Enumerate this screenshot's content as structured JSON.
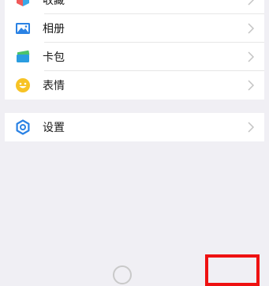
{
  "menu": {
    "items": [
      {
        "label": "收藏",
        "icon": "favorites-cube-icon"
      },
      {
        "label": "相册",
        "icon": "album-image-icon"
      },
      {
        "label": "卡包",
        "icon": "card-wallet-icon"
      },
      {
        "label": "表情",
        "icon": "emoji-smiley-icon"
      }
    ],
    "settings": {
      "label": "设置",
      "icon": "settings-gear-icon"
    }
  },
  "colors": {
    "background": "#f0eff4",
    "row": "#ffffff",
    "accent_blue": "#2a82e4",
    "highlight_red": "#ee1111"
  }
}
